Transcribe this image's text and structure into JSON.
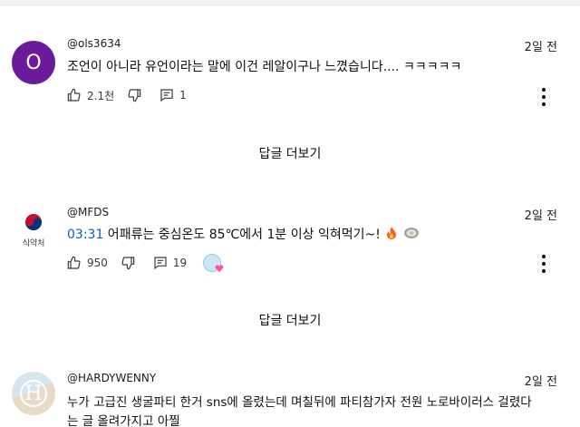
{
  "comments": [
    {
      "author": "@ols3634",
      "avatar_letter": "O",
      "avatar_color": "#6a1b9a",
      "time": "2일 전",
      "text": "조언이 아니라 유언이라는 말에 이건 레알이구나 느꼈습니다.... ㅋㅋㅋㅋㅋ",
      "likes": "2.1천",
      "replies": "1"
    },
    {
      "author": "@MFDS",
      "avatar_caption": "식약처",
      "time": "2일 전",
      "timestamp": "03:31",
      "text": " 어패류는 중심온도 85℃에서 1분 이상 익혀먹기~!",
      "likes": "950",
      "replies": "19"
    },
    {
      "author": "@HARDYWENNY",
      "avatar_letter": "H",
      "time": "2일 전",
      "text_line1": "누가 고급진 생굴파티 한거 sns에 올렸는데 며칠뒤에 파티참가자 전원 노로바이러스 걸렸다",
      "text_line2": "는 글 올려가지고 아찔"
    }
  ],
  "view_replies_label": "답글 더보기",
  "icons": [
    "thumbs-up-icon",
    "thumbs-down-icon",
    "reply-icon",
    "more-vert-icon",
    "fire-emoji-icon",
    "oyster-emoji-icon",
    "creator-heart-icon"
  ]
}
